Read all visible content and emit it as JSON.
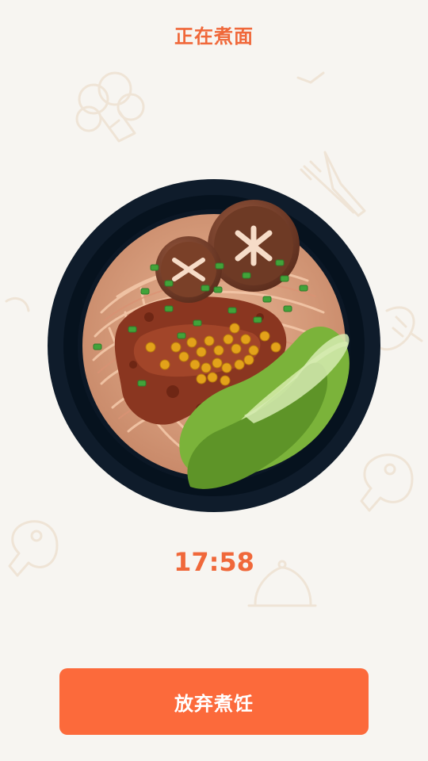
{
  "header": {
    "title": "正在煮面"
  },
  "cooking": {
    "timer": "17:58",
    "dish_icon": "noodle-bowl-illustration"
  },
  "actions": {
    "abandon_label": "放弃煮饪"
  },
  "background": {
    "doodle_icons": [
      "broccoli-icon",
      "fork-knife-icon",
      "shrimp-icon",
      "steak-icon",
      "cloche-icon"
    ]
  },
  "colors": {
    "accent": "#f0683a",
    "button": "#fc6a3b",
    "background": "#f7f5f1",
    "bowl": "#0f1c2b"
  }
}
